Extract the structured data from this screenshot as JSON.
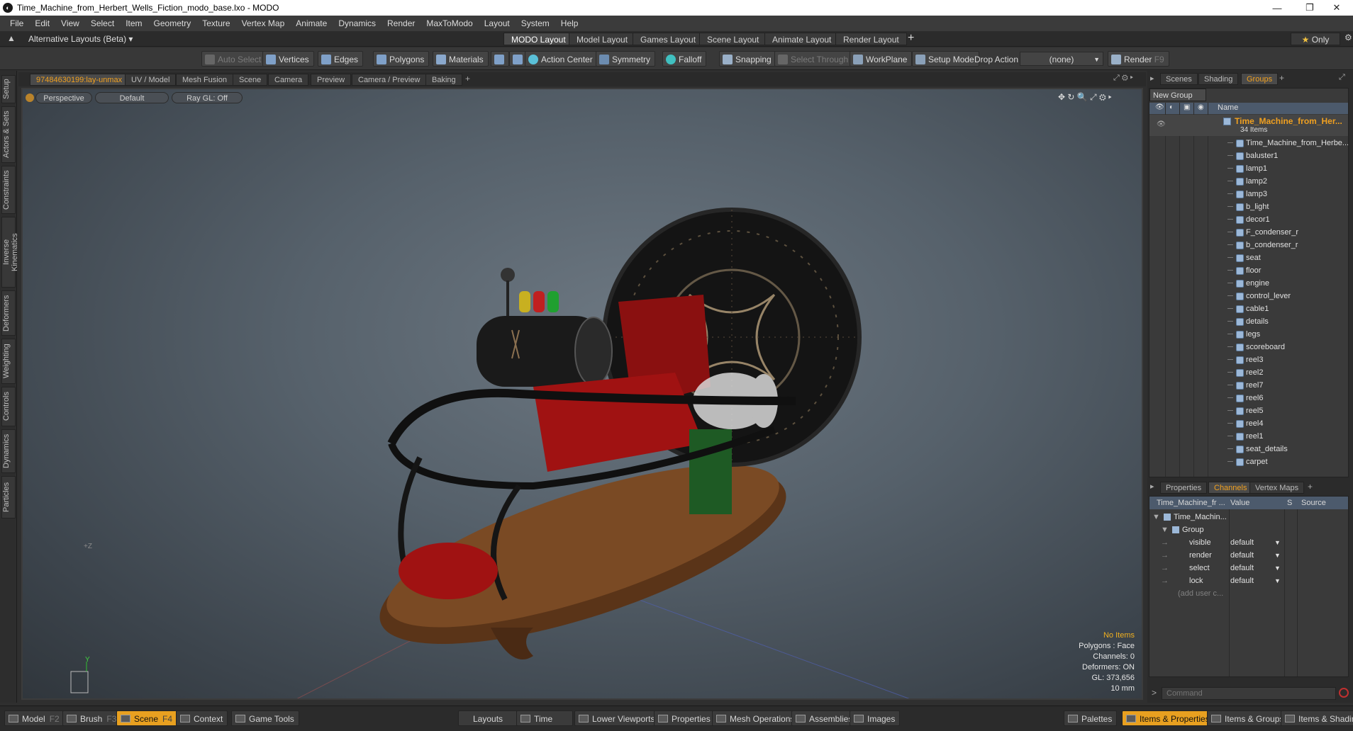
{
  "window": {
    "title": "Time_Machine_from_Herbert_Wells_Fiction_modo_base.lxo - MODO",
    "app_icon": "modo-icon"
  },
  "menu": [
    "File",
    "Edit",
    "View",
    "Select",
    "Item",
    "Geometry",
    "Texture",
    "Vertex Map",
    "Animate",
    "Dynamics",
    "Render",
    "MaxToModo",
    "Layout",
    "System",
    "Help"
  ],
  "layouts": {
    "alt_label": "Alternative Layouts (Beta)",
    "tabs": [
      "MODO Layout",
      "Model Layout",
      "Games Layout",
      "Scene Layout",
      "Animate Layout",
      "Render Layout"
    ],
    "active": "MODO Layout",
    "only_label": "Only"
  },
  "toolbar": {
    "auto_select": "Auto Select",
    "vertices": "Vertices",
    "edges": "Edges",
    "polygons": "Polygons",
    "materials": "Materials",
    "action_center": "Action Center",
    "symmetry": "Symmetry",
    "falloff": "Falloff",
    "snapping": "Snapping",
    "select_through": "Select Through",
    "workplane": "WorkPlane",
    "setup_mode": "Setup Mode",
    "drop_action_label": "Drop Action",
    "drop_action_value": "(none)",
    "render": "Render",
    "render_key": "F9"
  },
  "side_tabs": [
    "Setup",
    "Actors & Sets",
    "Constraints",
    "Inverse Kinematics",
    "Deformers",
    "Weighting",
    "Controls",
    "Dynamics",
    "Particles"
  ],
  "viewport_tabs": [
    "97484630199:lay-unmax",
    "UV / Model",
    "Mesh Fusion",
    "Scene",
    "Camera",
    "Preview",
    "Camera / Preview",
    "Baking"
  ],
  "viewport": {
    "view": "Perspective",
    "shading": "Default",
    "raygl": "Ray GL: Off",
    "stats": {
      "items": "No Items",
      "polygons": "Polygons : Face",
      "channels": "Channels: 0",
      "deformers": "Deformers: ON",
      "gl": "GL: 373,656",
      "unit": "10 mm"
    },
    "axis_y": "Y"
  },
  "groups_panel": {
    "tabs": [
      "Scenes",
      "Shading",
      "Groups"
    ],
    "active": "Groups",
    "new_group": "New Group",
    "name_header": "Name",
    "root": "Time_Machine_from_Her...",
    "root_count": "34 Items",
    "items": [
      "Time_Machine_from_Herbe...",
      "baluster1",
      "lamp1",
      "lamp2",
      "lamp3",
      "b_light",
      "decor1",
      "F_condenser_r",
      "b_condenser_r",
      "seat",
      "floor",
      "engine",
      "control_lever",
      "cable1",
      "details",
      "legs",
      "scoreboard",
      "reel3",
      "reel2",
      "reel7",
      "reel6",
      "reel5",
      "reel4",
      "reel1",
      "seat_details",
      "carpet"
    ]
  },
  "channels_panel": {
    "tabs": [
      "Properties",
      "Channels",
      "Vertex Maps"
    ],
    "active": "Channels",
    "headers": {
      "name": "Time_Machine_fr ...",
      "value": "Value",
      "s": "S",
      "source": "Source"
    },
    "root": "Time_Machin...",
    "group": "Group",
    "rows": [
      {
        "name": "visible",
        "value": "default"
      },
      {
        "name": "render",
        "value": "default"
      },
      {
        "name": "select",
        "value": "default"
      },
      {
        "name": "lock",
        "value": "default"
      }
    ],
    "add_user": "(add user c..."
  },
  "command": {
    "placeholder": "Command"
  },
  "bottom": {
    "left": [
      {
        "label": "Model",
        "key": "F2"
      },
      {
        "label": "Brush",
        "key": "F3"
      },
      {
        "label": "Scene",
        "key": "F4"
      },
      {
        "label": "Context",
        "key": ""
      },
      {
        "label": "Game Tools",
        "key": ""
      }
    ],
    "active": "Scene",
    "center": [
      "Layouts",
      "Time",
      "Lower Viewports",
      "Properties",
      "Mesh Operations",
      "Assemblies",
      "Images"
    ],
    "right": [
      "Palettes",
      "Items & Properties",
      "Items & Groups",
      "Items & Shading"
    ],
    "right_active": "Items & Properties"
  },
  "colors": {
    "accent": "#e8a020",
    "viewport_bg": "#56616b",
    "panel": "#3a3a3a"
  }
}
